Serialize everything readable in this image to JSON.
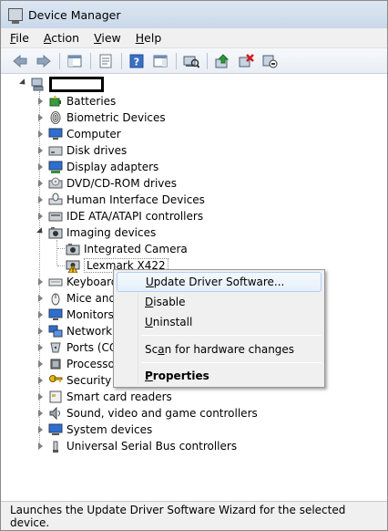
{
  "window": {
    "title": "Device Manager"
  },
  "menubar": {
    "items": [
      {
        "pre": "",
        "key": "F",
        "post": "ile"
      },
      {
        "pre": "",
        "key": "A",
        "post": "ction"
      },
      {
        "pre": "",
        "key": "V",
        "post": "iew"
      },
      {
        "pre": "",
        "key": "H",
        "post": "elp"
      }
    ]
  },
  "toolbar": {
    "buttons": [
      "back-arrow-icon",
      "forward-arrow-icon",
      "show-hide-console-tree-icon",
      "properties-icon",
      "help-icon",
      "show-action-pane-icon",
      "scan-hardware-icon",
      "update-driver-icon",
      "uninstall-icon",
      "disable-icon"
    ]
  },
  "tree": {
    "root_label": "",
    "items": [
      {
        "label": "Batteries",
        "icon": "battery-icon"
      },
      {
        "label": "Biometric Devices",
        "icon": "fingerprint-icon"
      },
      {
        "label": "Computer",
        "icon": "computer-icon"
      },
      {
        "label": "Disk drives",
        "icon": "disk-icon"
      },
      {
        "label": "Display adapters",
        "icon": "display-adapter-icon"
      },
      {
        "label": "DVD/CD-ROM drives",
        "icon": "dvd-icon"
      },
      {
        "label": "Human Interface Devices",
        "icon": "hid-icon"
      },
      {
        "label": "IDE ATA/ATAPI controllers",
        "icon": "ide-icon"
      },
      {
        "label": "Imaging devices",
        "icon": "camera-icon"
      },
      {
        "label": "Integrated Camera",
        "icon": "camera-icon"
      },
      {
        "label": "Lexmark X422",
        "icon": "warning-camera-icon"
      },
      {
        "label": "Keyboard",
        "icon": "keyboard-icon"
      },
      {
        "label": "Mice and",
        "icon": "mouse-icon"
      },
      {
        "label": "Monitors",
        "icon": "monitor-icon"
      },
      {
        "label": "Network a",
        "icon": "network-icon"
      },
      {
        "label": "Ports (CO",
        "icon": "port-icon"
      },
      {
        "label": "Processor",
        "icon": "processor-icon"
      },
      {
        "label": "Security D",
        "icon": "security-icon"
      },
      {
        "label": "Smart card readers",
        "icon": "smartcard-icon"
      },
      {
        "label": "Sound, video and game controllers",
        "icon": "sound-icon"
      },
      {
        "label": "System devices",
        "icon": "system-icon"
      },
      {
        "label": "Universal Serial Bus controllers",
        "icon": "usb-icon"
      }
    ]
  },
  "context_menu": {
    "update": {
      "pre": "",
      "key": "U",
      "post": "pdate Driver Software..."
    },
    "disable": {
      "pre": "",
      "key": "D",
      "post": "isable"
    },
    "uninstall": {
      "pre": "",
      "key": "U",
      "post": "ninstall"
    },
    "scan": {
      "pre": "Sc",
      "key": "a",
      "post": "n for hardware changes"
    },
    "properties": {
      "pre": "",
      "key": "P",
      "post": "roperties"
    }
  },
  "statusbar": {
    "text": "Launches the Update Driver Software Wizard for the selected device."
  }
}
